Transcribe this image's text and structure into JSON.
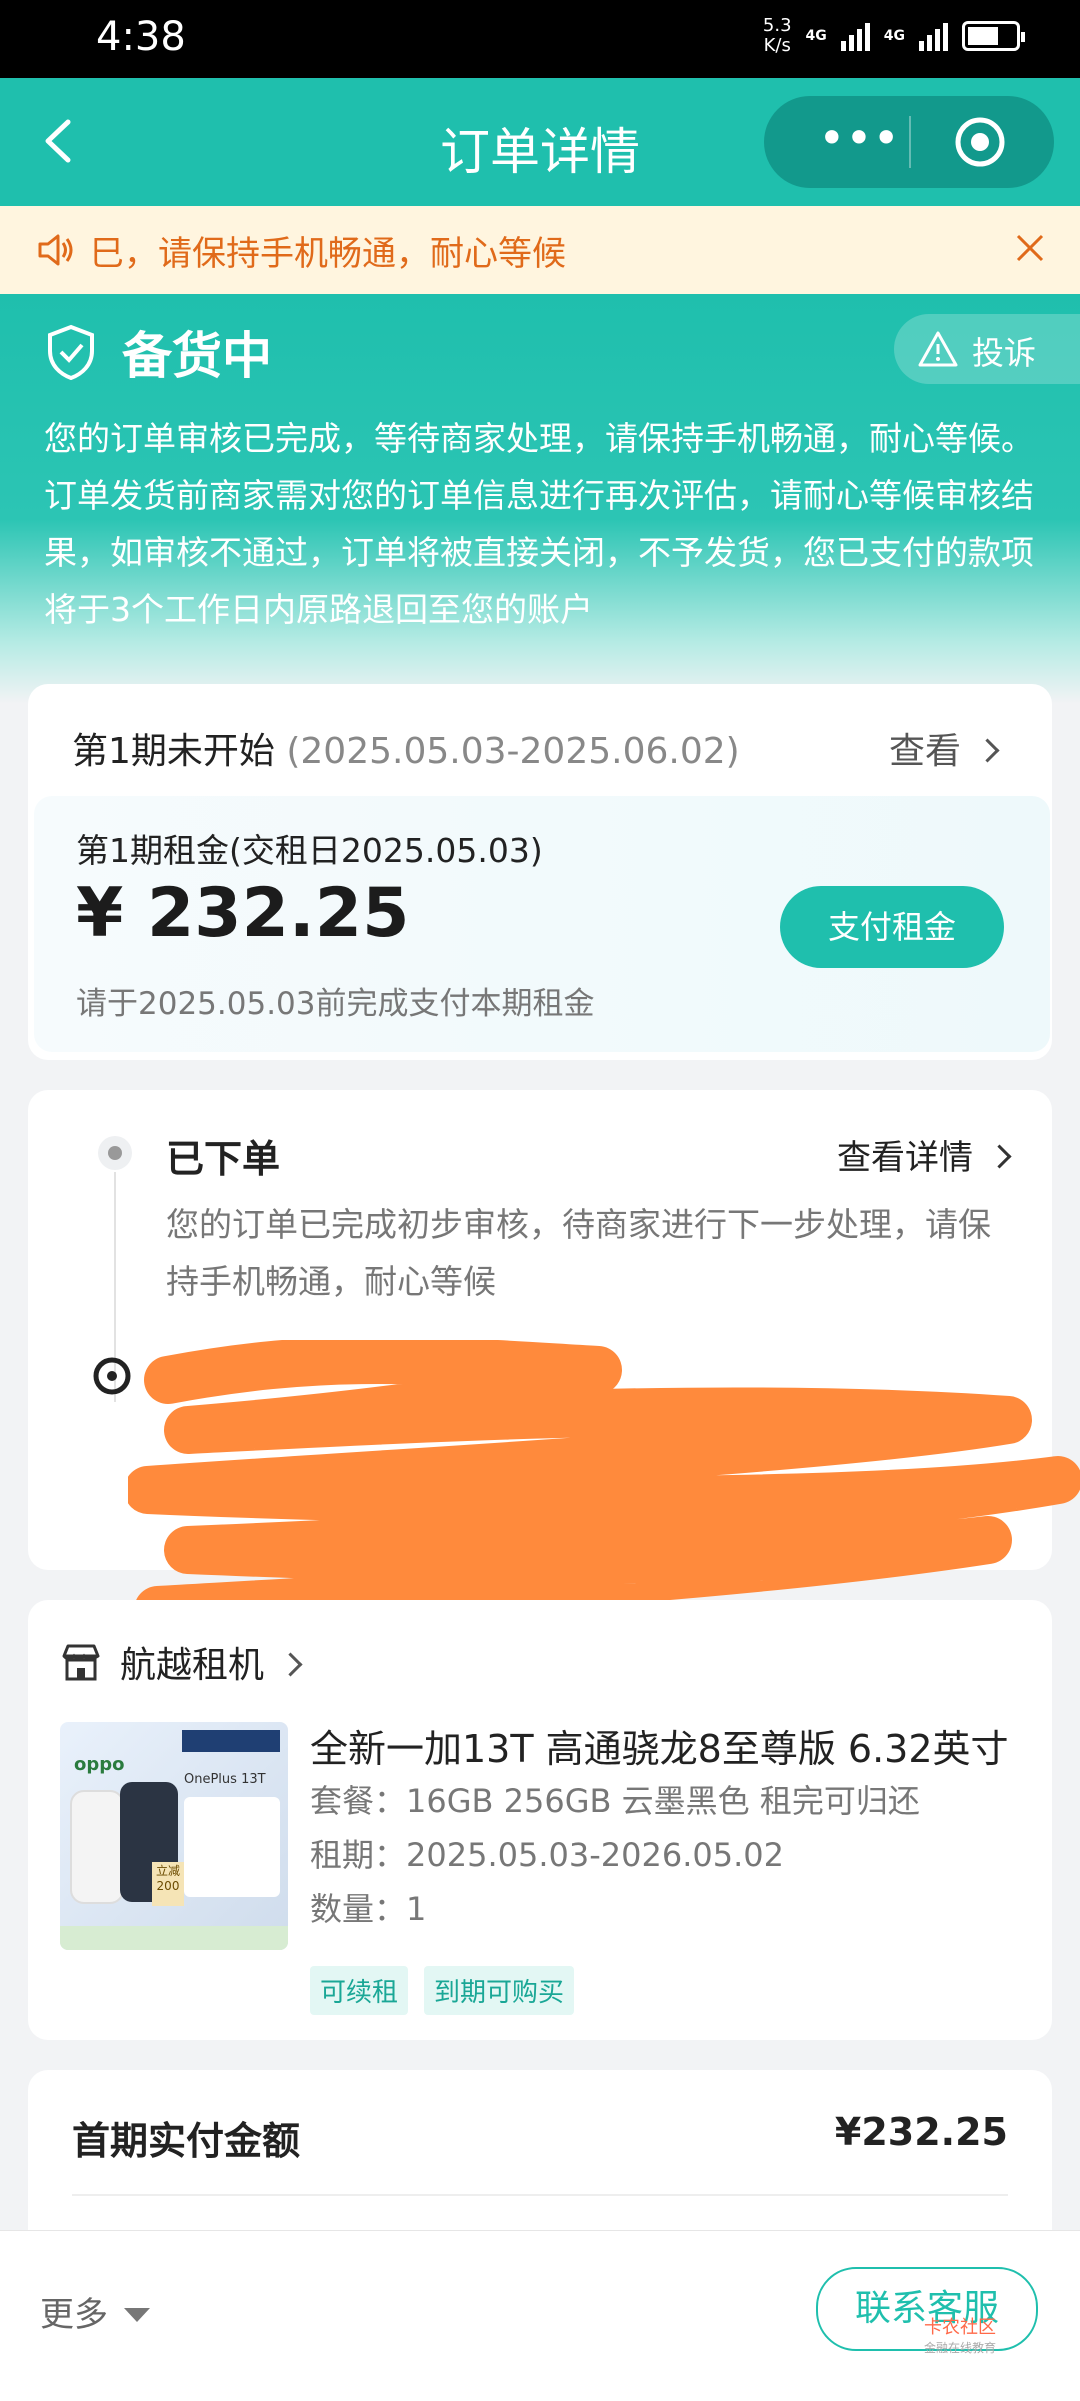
{
  "status_bar": {
    "time": "4:38",
    "net_speed_value": "5.3",
    "net_speed_unit": "K/s",
    "network_1": "4G",
    "network_2": "4G"
  },
  "nav": {
    "title": "订单详情",
    "menu_dots": "•••"
  },
  "notice": {
    "text": "巳，请保持手机畅通，耐心等候"
  },
  "order_status": {
    "title": "备货中",
    "complain_label": "投诉",
    "description": "您的订单审核已完成，等待商家处理，请保持手机畅通，耐心等候。订单发货前商家需对您的订单信息进行再次评估，请耐心等候审核结果，如审核不通过，订单将被直接关闭，不予发货，您已支付的款项将于3个工作日内原路退回至您的账户"
  },
  "period": {
    "title": "第1期未开始",
    "range": "(2025.05.03-2025.06.02)",
    "view_label": "查看",
    "rent_title": "第1期租金(交租日2025.05.03)",
    "amount": "¥ 232.25",
    "hint": "请于2025.05.03前完成支付本期租金",
    "pay_button": "支付租金"
  },
  "progress": {
    "step_title": "已下单",
    "detail_link": "查看详情",
    "step_desc": "您的订单已完成初步审核，待商家进行下一步处理，请保持手机畅通，耐心等候"
  },
  "product": {
    "store_name": "航越租机",
    "name": "全新一加13T 高通骁龙8至尊版 6.32英寸",
    "thumb_brand": "oppo",
    "thumb_model": "OnePlus 13T",
    "thumb_promo": "立减200",
    "package": "套餐：16GB 256GB 云墨黑色 租完可归还",
    "lease_term": "租期：2025.05.03-2026.05.02",
    "quantity": "数量：1",
    "badges": [
      "可续租",
      "到期可购买"
    ]
  },
  "payment": {
    "label": "首期实付金额",
    "value": "¥232.25"
  },
  "bottom": {
    "more_label": "更多",
    "contact_button": "联系客服",
    "watermark_main": "卡农社区",
    "watermark_sub": "金融在线教育"
  },
  "colors": {
    "primary": "#1fbfad",
    "notice_text": "#e06a1a",
    "notice_bg": "#fff5df",
    "redaction": "#ff8a3c"
  }
}
